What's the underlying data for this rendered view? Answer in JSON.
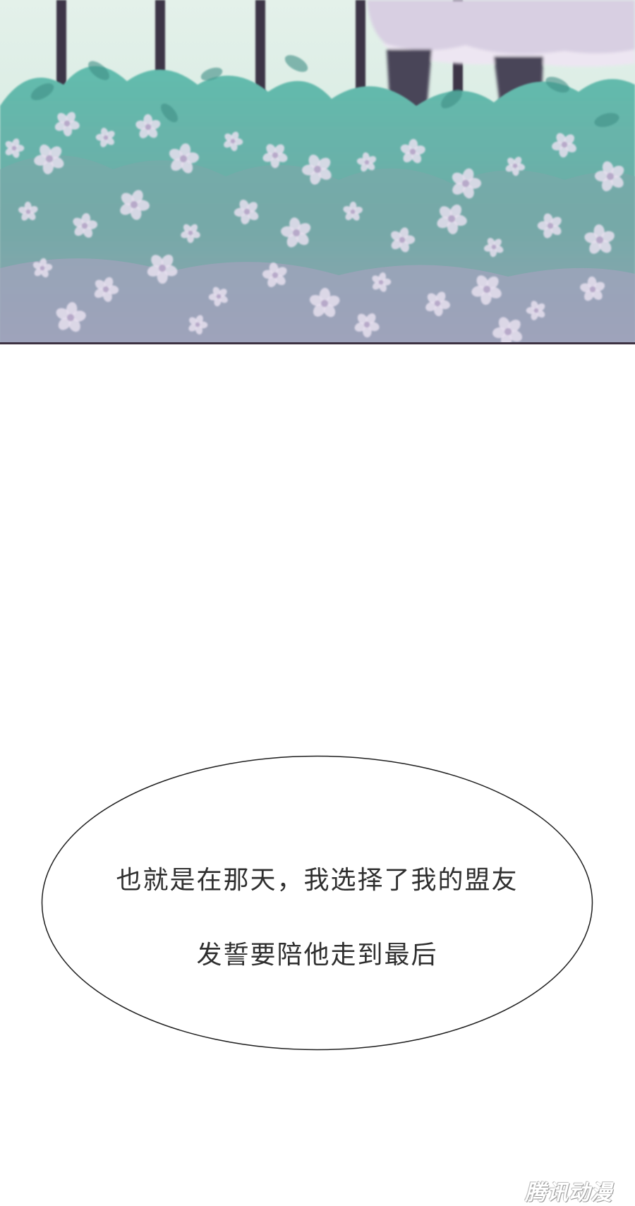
{
  "panel": {
    "palette": {
      "sky": "#d9ece4",
      "bars": "#3c3546",
      "foliage": "#5fb8a8",
      "foliage_dark": "#3f8f86",
      "flowers": "#e6dfee",
      "dress": "#d8cfe2",
      "legs": "#4a4458",
      "border": "#3d3242"
    }
  },
  "speech_bubble": {
    "line_1": "也就是在那天，我选择了我的盟友",
    "line_2": "发誓要陪他走到最后"
  },
  "watermark": {
    "text": "腾讯动漫"
  }
}
